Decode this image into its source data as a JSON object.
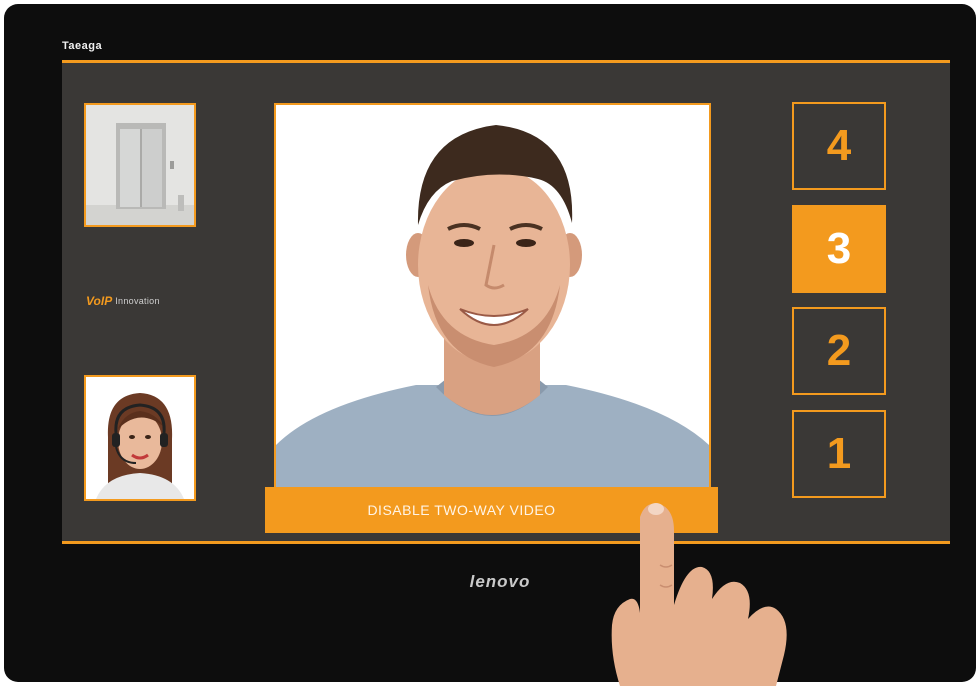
{
  "header": {
    "app_label": "Taeaga"
  },
  "sidebar": {
    "logo_mark": "VoIP",
    "logo_text": "Innovation"
  },
  "video": {
    "disable_button_label": "DISABLE TWO-WAY VIDEO"
  },
  "floors": [
    {
      "label": "4",
      "active": false
    },
    {
      "label": "3",
      "active": true
    },
    {
      "label": "2",
      "active": false
    },
    {
      "label": "1",
      "active": false
    }
  ],
  "device": {
    "brand": "lenovo"
  },
  "colors": {
    "accent": "#f39a1e",
    "screen": "#3a3836",
    "bezel": "#0d0d0d"
  }
}
